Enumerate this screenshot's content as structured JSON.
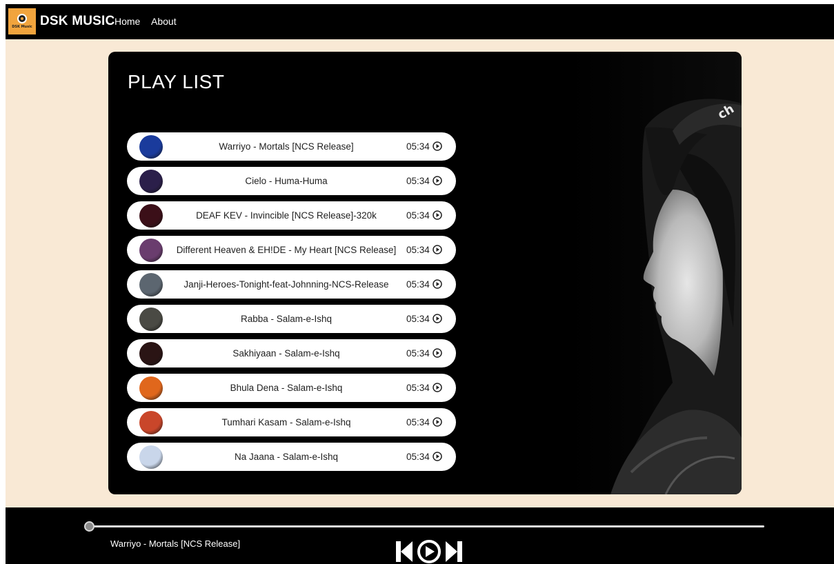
{
  "app": {
    "logo_text": "DSK Music",
    "brand": "DSK MUSIC",
    "nav": {
      "home": "Home",
      "about": "About"
    }
  },
  "playlist": {
    "title": "PLAY LIST",
    "songs": [
      {
        "name": "Warriyo - Mortals [NCS Release]",
        "duration": "05:34",
        "thumb_color": "#1a3b9c"
      },
      {
        "name": "Cielo - Huma-Huma",
        "duration": "05:34",
        "thumb_color": "#2b1f4a"
      },
      {
        "name": "DEAF KEV - Invincible [NCS Release]-320k",
        "duration": "05:34",
        "thumb_color": "#3b0f18"
      },
      {
        "name": "Different Heaven & EH!DE - My Heart [NCS Release]",
        "duration": "05:34",
        "thumb_color": "#6a3d6e"
      },
      {
        "name": "Janji-Heroes-Tonight-feat-Johnning-NCS-Release",
        "duration": "05:34",
        "thumb_color": "#5c6670"
      },
      {
        "name": "Rabba - Salam-e-Ishq",
        "duration": "05:34",
        "thumb_color": "#4a4a44"
      },
      {
        "name": "Sakhiyaan - Salam-e-Ishq",
        "duration": "05:34",
        "thumb_color": "#2a1414"
      },
      {
        "name": "Bhula Dena - Salam-e-Ishq",
        "duration": "05:34",
        "thumb_color": "#e0671c"
      },
      {
        "name": "Tumhari Kasam - Salam-e-Ishq",
        "duration": "05:34",
        "thumb_color": "#c9462a"
      },
      {
        "name": "Na Jaana - Salam-e-Ishq",
        "duration": "05:34",
        "thumb_color": "#c9d6ea"
      }
    ]
  },
  "player": {
    "current_song": "Warriyo - Mortals [NCS Release]",
    "progress": 0
  },
  "colors": {
    "background": "#f9e9d5",
    "logo": "#f1a43d",
    "dark": "#000000"
  },
  "icons": {
    "play": "play-circle-icon",
    "prev": "skip-previous-icon",
    "next": "skip-next-icon"
  }
}
